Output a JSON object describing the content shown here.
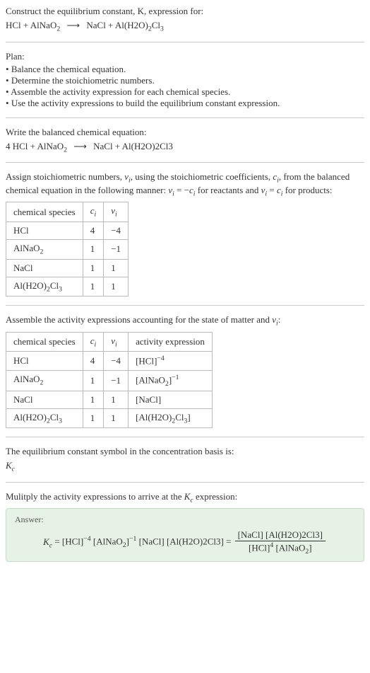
{
  "header": {
    "title": "Construct the equilibrium constant, K, expression for:",
    "equation_html": "HCl + AlNaO<sub>2</sub> <span class='arrow'>⟶</span> NaCl + Al(H2O)<sub>2</sub>Cl<sub>3</sub>"
  },
  "plan": {
    "title": "Plan:",
    "items": [
      "Balance the chemical equation.",
      "Determine the stoichiometric numbers.",
      "Assemble the activity expression for each chemical species.",
      "Use the activity expressions to build the equilibrium constant expression."
    ]
  },
  "balanced": {
    "intro": "Write the balanced chemical equation:",
    "equation_html": "4 HCl + AlNaO<sub>2</sub> <span class='arrow'>⟶</span> NaCl + Al(H2O)2Cl3"
  },
  "stoich": {
    "intro_html": "Assign stoichiometric numbers, <span class='italic'>ν<sub>i</sub></span>, using the stoichiometric coefficients, <span class='italic'>c<sub>i</sub></span>, from the balanced chemical equation in the following manner: <span class='italic'>ν<sub>i</sub></span> = −<span class='italic'>c<sub>i</sub></span> for reactants and <span class='italic'>ν<sub>i</sub></span> = <span class='italic'>c<sub>i</sub></span> for products:",
    "headers": [
      "chemical species",
      "c_i",
      "ν_i"
    ],
    "headers_html": [
      "chemical species",
      "<span class='italic'>c<sub>i</sub></span>",
      "<span class='italic'>ν<sub>i</sub></span>"
    ],
    "rows": [
      {
        "species_html": "HCl",
        "ci": "4",
        "vi": "−4"
      },
      {
        "species_html": "AlNaO<sub>2</sub>",
        "ci": "1",
        "vi": "−1"
      },
      {
        "species_html": "NaCl",
        "ci": "1",
        "vi": "1"
      },
      {
        "species_html": "Al(H2O)<sub>2</sub>Cl<sub>3</sub>",
        "ci": "1",
        "vi": "1"
      }
    ]
  },
  "activity": {
    "intro_html": "Assemble the activity expressions accounting for the state of matter and <span class='italic'>ν<sub>i</sub></span>:",
    "headers_html": [
      "chemical species",
      "<span class='italic'>c<sub>i</sub></span>",
      "<span class='italic'>ν<sub>i</sub></span>",
      "activity expression"
    ],
    "rows": [
      {
        "species_html": "HCl",
        "ci": "4",
        "vi": "−4",
        "expr_html": "[HCl]<sup>−4</sup>"
      },
      {
        "species_html": "AlNaO<sub>2</sub>",
        "ci": "1",
        "vi": "−1",
        "expr_html": "[AlNaO<sub>2</sub>]<sup>−1</sup>"
      },
      {
        "species_html": "NaCl",
        "ci": "1",
        "vi": "1",
        "expr_html": "[NaCl]"
      },
      {
        "species_html": "Al(H2O)<sub>2</sub>Cl<sub>3</sub>",
        "ci": "1",
        "vi": "1",
        "expr_html": "[Al(H2O)<sub>2</sub>Cl<sub>3</sub>]"
      }
    ]
  },
  "constant": {
    "intro": "The equilibrium constant symbol in the concentration basis is:",
    "symbol_html": "<span class='italic'>K<sub>c</sub></span>"
  },
  "multiply": {
    "intro_html": "Mulitply the activity expressions to arrive at the <span class='italic'>K<sub>c</sub></span> expression:"
  },
  "answer": {
    "label": "Answer:",
    "expr_html": "<span class='italic'>K<sub>c</sub></span> = [HCl]<sup>−4</sup> [AlNaO<sub>2</sub>]<sup>−1</sup> [NaCl] [Al(H2O)2Cl3] = <span class='fraction'><span class='num'>[NaCl] [Al(H2O)2Cl3]</span><span class='den'>[HCl]<sup>4</sup> [AlNaO<sub>2</sub>]</span></span>"
  },
  "chart_data": {
    "type": "table",
    "tables": [
      {
        "title": "Stoichiometric numbers",
        "columns": [
          "chemical species",
          "c_i",
          "ν_i"
        ],
        "rows": [
          [
            "HCl",
            4,
            -4
          ],
          [
            "AlNaO2",
            1,
            -1
          ],
          [
            "NaCl",
            1,
            1
          ],
          [
            "Al(H2O)2Cl3",
            1,
            1
          ]
        ]
      },
      {
        "title": "Activity expressions",
        "columns": [
          "chemical species",
          "c_i",
          "ν_i",
          "activity expression"
        ],
        "rows": [
          [
            "HCl",
            4,
            -4,
            "[HCl]^-4"
          ],
          [
            "AlNaO2",
            1,
            -1,
            "[AlNaO2]^-1"
          ],
          [
            "NaCl",
            1,
            1,
            "[NaCl]"
          ],
          [
            "Al(H2O)2Cl3",
            1,
            1,
            "[Al(H2O)2Cl3]"
          ]
        ]
      }
    ]
  }
}
